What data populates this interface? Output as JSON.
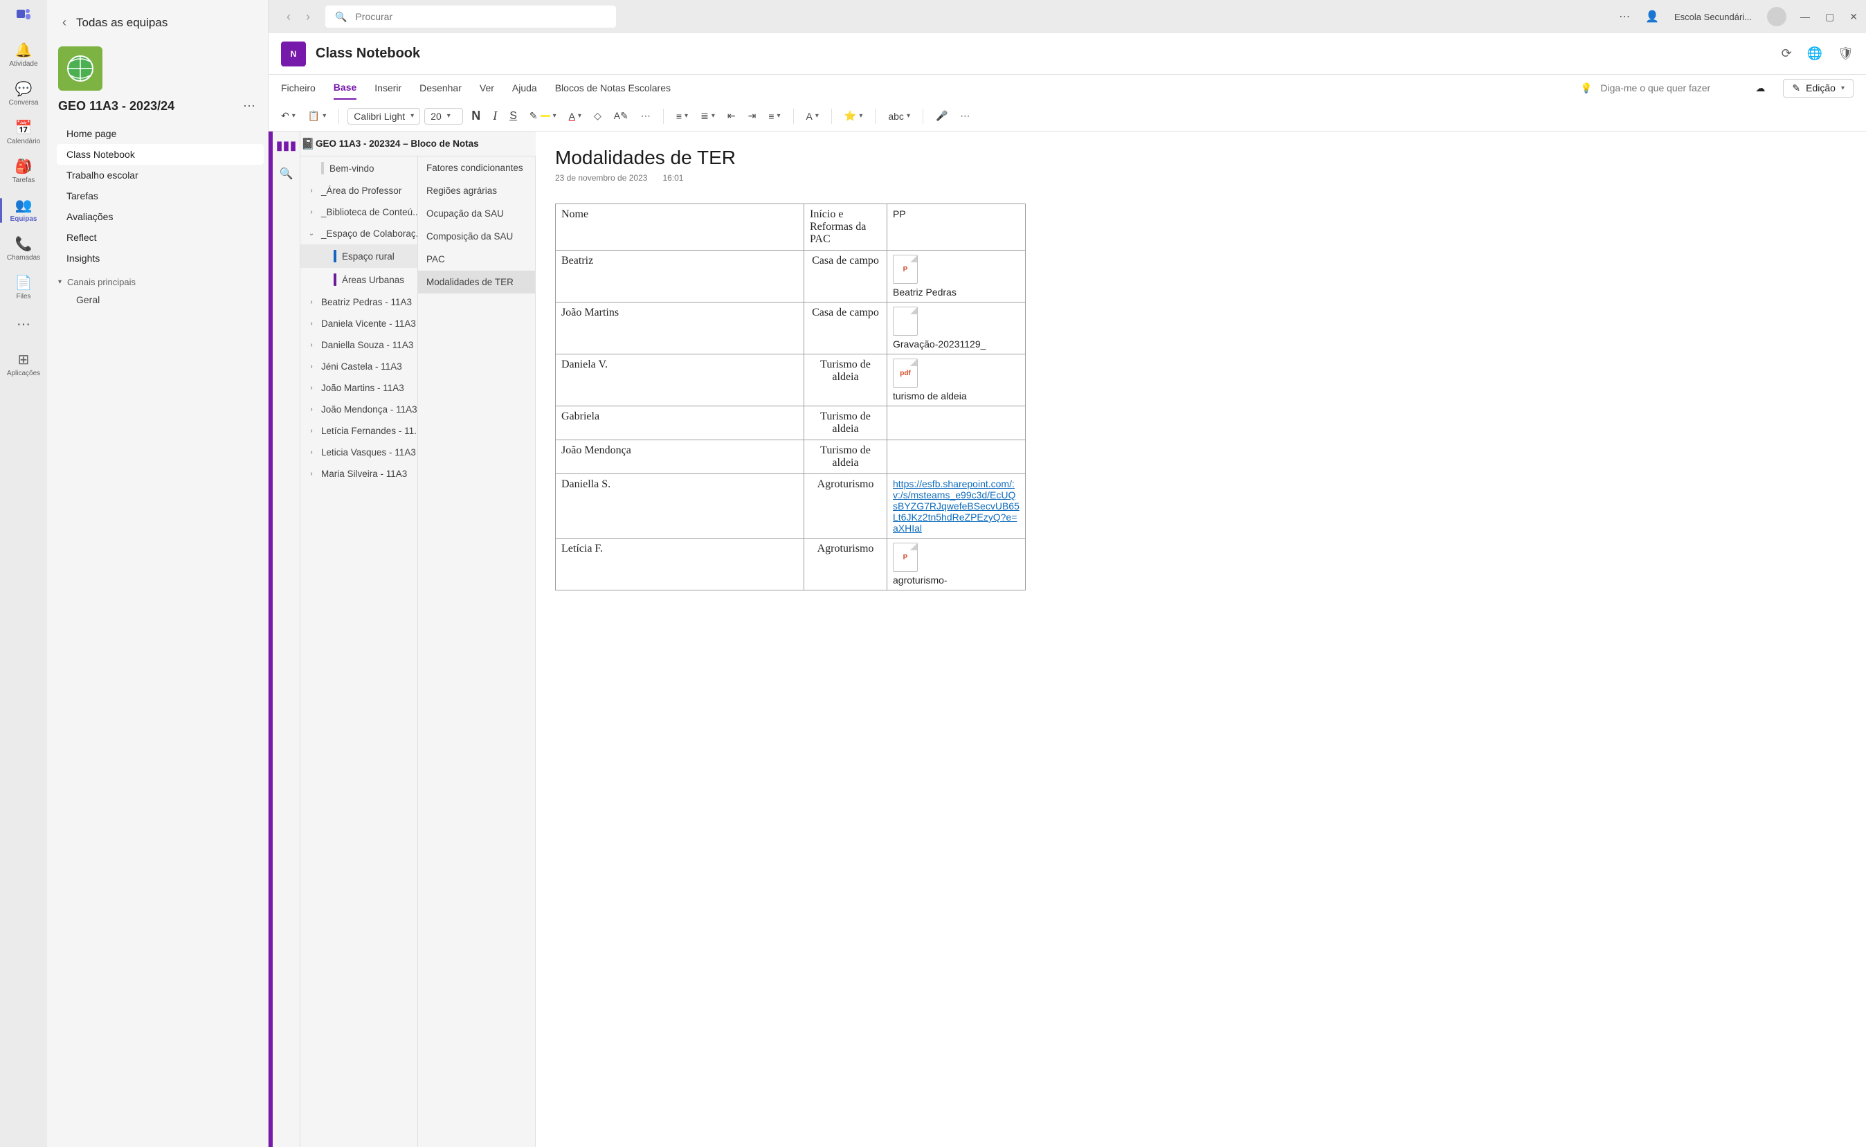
{
  "titlebar": {
    "search_placeholder": "Procurar",
    "org_name": "Escola Secundári..."
  },
  "rail": {
    "items": [
      {
        "label": "Atividade"
      },
      {
        "label": "Conversa"
      },
      {
        "label": "Calendário"
      },
      {
        "label": "Tarefas"
      },
      {
        "label": "Equipas"
      },
      {
        "label": "Chamadas"
      },
      {
        "label": "Files"
      }
    ],
    "apps_label": "Aplicações"
  },
  "teams": {
    "back_label": "Todas as equipas",
    "team_name": "GEO 11A3 - 2023/24",
    "channels": [
      "Home page",
      "Class Notebook",
      "Trabalho escolar",
      "Tarefas",
      "Avaliações",
      "Reflect",
      "Insights"
    ],
    "section_hdr": "Canais principais",
    "general": "Geral"
  },
  "tab": {
    "title": "Class Notebook"
  },
  "ribbon": {
    "tabs": [
      "Ficheiro",
      "Base",
      "Inserir",
      "Desenhar",
      "Ver",
      "Ajuda",
      "Blocos de Notas Escolares"
    ],
    "tell_placeholder": "Diga-me o que quer fazer",
    "edit_label": "Edição"
  },
  "toolbar": {
    "font": "Calibri Light",
    "size": "20",
    "abc": "abc"
  },
  "notebook": {
    "nb_title": "GEO 11A3 - 202324 – Bloco de Notas",
    "sections": [
      {
        "label": "Bem-vindo",
        "chev": "",
        "tab": "#d0d0d0",
        "lvl": 0
      },
      {
        "label": "_Área do Professor",
        "chev": "›",
        "tab": "",
        "lvl": 0
      },
      {
        "label": "_Biblioteca de Conteú...",
        "chev": "›",
        "tab": "",
        "lvl": 0
      },
      {
        "label": "_Espaço de Colaboraç...",
        "chev": "⌄",
        "tab": "",
        "lvl": 0
      },
      {
        "label": "Espaço rural",
        "chev": "",
        "tab": "#1565c0",
        "lvl": 1,
        "sel": true
      },
      {
        "label": "Áreas Urbanas",
        "chev": "",
        "tab": "#6a1b9a",
        "lvl": 1
      },
      {
        "label": "Beatriz Pedras - 11A3",
        "chev": "›",
        "tab": "",
        "lvl": 0
      },
      {
        "label": "Daniela Vicente - 11A3",
        "chev": "›",
        "tab": "",
        "lvl": 0
      },
      {
        "label": "Daniella Souza - 11A3",
        "chev": "›",
        "tab": "",
        "lvl": 0
      },
      {
        "label": "Jéni Castela - 11A3",
        "chev": "›",
        "tab": "",
        "lvl": 0
      },
      {
        "label": "João Martins - 11A3",
        "chev": "›",
        "tab": "",
        "lvl": 0
      },
      {
        "label": "João Mendonça - 11A3",
        "chev": "›",
        "tab": "",
        "lvl": 0
      },
      {
        "label": "Letícia Fernandes - 11...",
        "chev": "›",
        "tab": "",
        "lvl": 0
      },
      {
        "label": "Leticia Vasques - 11A3",
        "chev": "›",
        "tab": "",
        "lvl": 0
      },
      {
        "label": "Maria Silveira - 11A3",
        "chev": "›",
        "tab": "",
        "lvl": 0
      }
    ],
    "pages": [
      "Fatores condicionantes",
      "Regiões agrárias",
      "Ocupação da SAU",
      "Composição da SAU",
      "PAC",
      "Modalidades de TER"
    ]
  },
  "note": {
    "title": "Modalidades de TER",
    "date": "23 de novembro de 2023",
    "time": "16:01",
    "hdr": {
      "c1": "Nome",
      "c2": "Início e Reformas da PAC",
      "c3": "PP"
    },
    "rows": [
      {
        "c1": "Beatriz",
        "c2": "Casa de campo",
        "att": {
          "type": "ppt",
          "label": "Beatriz Pedras"
        }
      },
      {
        "c1": "João Martins",
        "c2": "Casa de campo",
        "att": {
          "type": "file",
          "label": "Gravação-20231129_"
        }
      },
      {
        "c1": "Daniela V.",
        "c2": "Turismo de aldeia",
        "att": {
          "type": "pdf",
          "label": "turismo de aldeia"
        }
      },
      {
        "c1": "Gabriela",
        "c2": "Turismo de aldeia"
      },
      {
        "c1": "João Mendonça",
        "c2": "Turismo de aldeia"
      },
      {
        "c1": "Daniella S.",
        "c2": "Agroturismo",
        "link": "https://esfb.sharepoint.com/:v:/s/msteams_e99c3d/EcUQsBYZG7RJqwefeBSecvUB65Lt6JKz2tn5hdReZPEzyQ?e=aXHIal"
      },
      {
        "c1": "Letícia F.",
        "c2": "Agroturismo",
        "att": {
          "type": "ppt",
          "label": "agroturismo-"
        }
      }
    ]
  }
}
